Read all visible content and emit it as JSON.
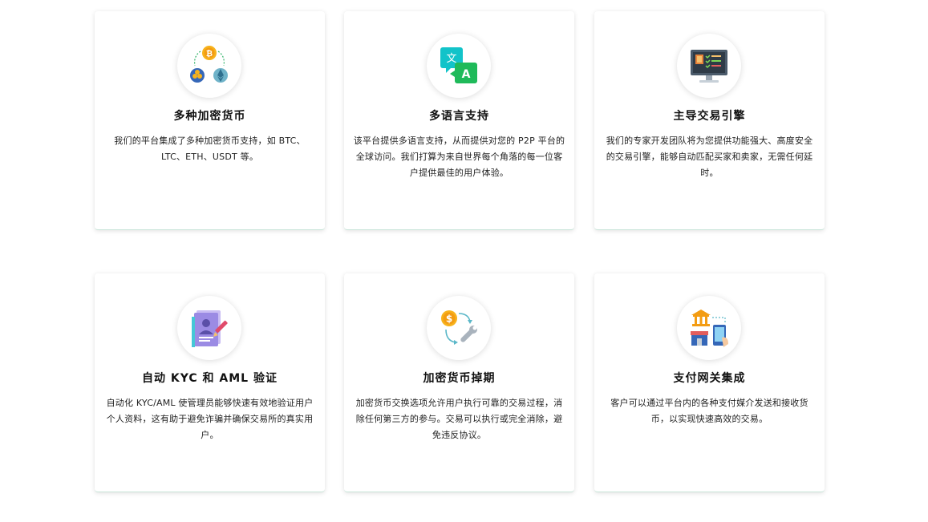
{
  "features": [
    {
      "title": "多种加密货币",
      "description": "我们的平台集成了多种加密货币支持，如 BTC、LTC、ETH、USDT 等。",
      "icon": "cryptocurrency-icon"
    },
    {
      "title": "多语言支持",
      "description": "该平台提供多语言支持，从而提供对您的 P2P 平台的全球访问。我们打算为来自世界每个角落的每一位客户提供最佳的用户体验。",
      "icon": "translate-icon"
    },
    {
      "title": "主导交易引擎",
      "description": "我们的专家开发团队将为您提供功能强大、高度安全的交易引擎，能够自动匹配买家和卖家，无需任何延时。",
      "icon": "trading-monitor-icon"
    },
    {
      "title": "自动 KYC 和 AML 验证",
      "description": "自动化 KYC/AML 使管理员能够快速有效地验证用户个人资料，这有助于避免诈骗并确保交易所的真实用户。",
      "icon": "kyc-document-icon"
    },
    {
      "title": "加密货币掉期",
      "description": "加密货币交换选项允许用户执行可靠的交易过程，消除任何第三方的参与。交易可以执行或完全消除，避免违反协议。",
      "icon": "swap-tools-icon"
    },
    {
      "title": "支付网关集成",
      "description": "客户可以通过平台内的各种支付媒介发送和接收货币，以实现快速高效的交易。",
      "icon": "payment-gateway-icon"
    }
  ],
  "colors": {
    "bitcoin": "#f7b21b",
    "translate_teal": "#12c3c9",
    "translate_green": "#1fba5a",
    "monitor": "#4a5a6a",
    "document": "#9b8be4",
    "card_border": "#c9e4d9"
  }
}
